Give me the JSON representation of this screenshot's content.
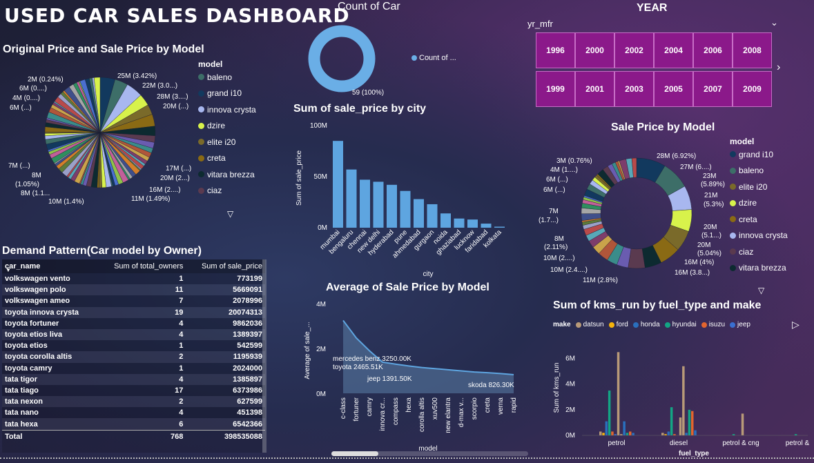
{
  "dashboard": {
    "title": "USED CAR SALES DASHBOARD"
  },
  "donut_count": {
    "title": "Count of Car",
    "legend_label": "Count of ...",
    "data_label": "59 (100%)",
    "color": "#6aaee6",
    "chart_data": {
      "type": "pie",
      "values": [
        59
      ],
      "labels": [
        "Count of ..."
      ]
    }
  },
  "year_slicer": {
    "title": "YEAR",
    "field": "yr_mfr",
    "years_row1": [
      "1996",
      "2000",
      "2002",
      "2004",
      "2006",
      "2008"
    ],
    "years_row2": [
      "1999",
      "2001",
      "2003",
      "2005",
      "2007",
      "2009"
    ],
    "button_color": "#8b198a"
  },
  "pie_orig": {
    "title": "Original Price and Sale Price by Model",
    "legend_title": "model",
    "legend": [
      {
        "name": "baleno",
        "color": "#3d6e68"
      },
      {
        "name": "grand i10",
        "color": "#12395e"
      },
      {
        "name": "innova crysta",
        "color": "#a8b7ef"
      },
      {
        "name": "dzire",
        "color": "#d8f24b"
      },
      {
        "name": "elite i20",
        "color": "#7a6a2a"
      },
      {
        "name": "creta",
        "color": "#8a6a14"
      },
      {
        "name": "vitara brezza",
        "color": "#0d2a30"
      },
      {
        "name": "ciaz",
        "color": "#5a3a4f"
      }
    ],
    "labels_left": [
      "2M (0.24%)",
      "6M (0....)",
      "4M (0....)",
      "6M (...)",
      "7M (...)",
      "8M",
      "(1.05%)",
      "8M (1.1...",
      "10M (1.4%)"
    ],
    "labels_right": [
      "25M (3.42%)",
      "22M (3.0...)",
      "28M (3....)",
      "20M (...)",
      "17M (...)",
      "20M (2...)",
      "16M (2....)",
      "11M (1.49%)"
    ],
    "chart_data": {
      "type": "pie",
      "values_m": [
        25,
        22,
        28,
        20,
        17,
        20,
        16,
        11,
        10,
        8,
        8,
        7,
        6,
        4,
        6,
        2
      ],
      "labels": [
        "25M (3.42%)",
        "22M (3.0...)",
        "28M (3....)",
        "20M (...)",
        "17M (...)",
        "20M (2...)",
        "16M (2....)",
        "11M (1.49%)",
        "10M (1.4%)",
        "8M (1.1...",
        "8M (1.05%)",
        "7M (...)",
        "6M (...)",
        "4M (0....)",
        "6M (0....)",
        "2M (0.24%)"
      ]
    }
  },
  "bar_city": {
    "title": "Sum of sale_price by city",
    "xlabel": "city",
    "ylabel": "Sum of sale_price",
    "yticks": [
      "100M",
      "50M",
      "0M"
    ],
    "color": "#5ea5e0",
    "chart_data": {
      "type": "bar",
      "categories": [
        "mumbai",
        "bengaluru",
        "chennai",
        "new delhi",
        "hyderabad",
        "pune",
        "ahmedabad",
        "gurgaon",
        "noida",
        "ghaziabad",
        "lucknow",
        "faridabad",
        "kolkata"
      ],
      "values": [
        85,
        57,
        47,
        45,
        42,
        36,
        28,
        23,
        14,
        9,
        8,
        4,
        1
      ],
      "ylim": [
        0,
        100
      ]
    }
  },
  "area_avg": {
    "title": "Average of Sale Price by Model",
    "xlabel": "model",
    "ylabel": "Average of sale_...",
    "yticks": [
      "4M",
      "2M",
      "0M"
    ],
    "annotations": [
      "mercedes benz 3250.00K",
      "toyota 2465.51K",
      "jeep 1391.50K",
      "skoda 826.30K"
    ],
    "chart_data": {
      "type": "area",
      "categories": [
        "c-class",
        "fortuner",
        "camry",
        "innova cr...",
        "compass",
        "hexa",
        "corolla altis",
        "xuv500",
        "new elantra",
        "d-max v...",
        "scorpio",
        "creta",
        "verna",
        "rapid"
      ],
      "values": [
        3.25,
        2.47,
        1.9,
        1.39,
        1.3,
        1.22,
        1.15,
        1.1,
        1.05,
        1.0,
        0.95,
        0.92,
        0.88,
        0.83
      ],
      "ylim": [
        0,
        4
      ]
    }
  },
  "pie_sale": {
    "title": "Sale Price by Model",
    "legend_title": "model",
    "legend": [
      {
        "name": "grand i10",
        "color": "#12395e"
      },
      {
        "name": "baleno",
        "color": "#3d6e68"
      },
      {
        "name": "elite i20",
        "color": "#7a6a2a"
      },
      {
        "name": "dzire",
        "color": "#d8f24b"
      },
      {
        "name": "creta",
        "color": "#8a6a14"
      },
      {
        "name": "innova crysta",
        "color": "#a8b7ef"
      },
      {
        "name": "ciaz",
        "color": "#5a3a4f"
      },
      {
        "name": "vitara brezza",
        "color": "#0d2a30"
      }
    ],
    "labels_left": [
      "3M (0.76%)",
      "4M (1....)",
      "6M (...)",
      "6M (...)",
      "7M",
      "(1.7...)",
      "8M",
      "(2.11%)",
      "10M (2....)",
      "10M (2.4....)",
      "11M (2.8%)"
    ],
    "labels_right": [
      "28M (6.92%)",
      "27M (6....)",
      "23M",
      "(5.89%)",
      "21M",
      "(5.3%)",
      "20M",
      "(5.1...)",
      "20M",
      "(5.04%)",
      "16M (4%)",
      "16M (3.8...)"
    ],
    "chart_data": {
      "type": "pie",
      "values_m": [
        28,
        27,
        23,
        21,
        20,
        20,
        16,
        16,
        11,
        10,
        10,
        8,
        7,
        6,
        6,
        4,
        3
      ]
    }
  },
  "bar_kms": {
    "title": "Sum of kms_run by fuel_type and make",
    "legend_title": "make",
    "legend": [
      {
        "name": "datsun",
        "color": "#b89a78"
      },
      {
        "name": "ford",
        "color": "#f6b40c"
      },
      {
        "name": "honda",
        "color": "#2a6fbd"
      },
      {
        "name": "hyundai",
        "color": "#13a584"
      },
      {
        "name": "isuzu",
        "color": "#e2652e"
      },
      {
        "name": "jeep",
        "color": "#3a6fd0"
      }
    ],
    "xlabel": "fuel_type",
    "ylabel": "Sum of kms_run",
    "yticks": [
      "6M",
      "4M",
      "2M",
      "0M"
    ],
    "chart_data": {
      "type": "bar",
      "categories": [
        "petrol",
        "diesel",
        "petrol & cng",
        "petrol & lpg"
      ],
      "series_values_m": [
        [
          0.3,
          0.2,
          1.1,
          3.5,
          0.3,
          0.1,
          6.5,
          0.1,
          1.1,
          0.2,
          0.3,
          0.2
        ],
        [
          0.2,
          0.1,
          0.3,
          2.2,
          0.1,
          0.0,
          1.4,
          5.4,
          0.2,
          2.0,
          1.9,
          0.4
        ],
        [
          0.0,
          0.0,
          0.0,
          0.1,
          0.0,
          0.0,
          1.7,
          0.0,
          0.0,
          0.0,
          0.0,
          0.0
        ],
        [
          0.0,
          0.0,
          0.0,
          0.1,
          0.0,
          0.0,
          0.0,
          0.0,
          0.0,
          0.0,
          0.0,
          0.0
        ]
      ],
      "bar_colors": [
        "#b89a78",
        "#f6b40c",
        "#2a6fbd",
        "#13a584",
        "#e2652e",
        "#3a6fd0",
        "#b89a78",
        "#b89a78",
        "#2a6fbd",
        "#13a584",
        "#e2652e",
        "#2a6fbd"
      ],
      "ylim": [
        0,
        7
      ]
    }
  },
  "table": {
    "title": "Demand Pattern(Car model by Owner)",
    "headers": [
      "car_name",
      "Sum of total_owners",
      "Sum of sale_price"
    ],
    "rows": [
      [
        "volkswagen vento",
        "1",
        "773199"
      ],
      [
        "volkswagen polo",
        "11",
        "5669091"
      ],
      [
        "volkswagen ameo",
        "7",
        "2078996"
      ],
      [
        "toyota innova crysta",
        "19",
        "20074313"
      ],
      [
        "toyota fortuner",
        "4",
        "9862036"
      ],
      [
        "toyota etios liva",
        "4",
        "1389397"
      ],
      [
        "toyota etios",
        "1",
        "542599"
      ],
      [
        "toyota corolla altis",
        "2",
        "1195939"
      ],
      [
        "toyota camry",
        "1",
        "2024000"
      ],
      [
        "tata tigor",
        "4",
        "1385897"
      ],
      [
        "tata tiago",
        "17",
        "6373986"
      ],
      [
        "tata nexon",
        "2",
        "627599"
      ],
      [
        "tata nano",
        "4",
        "451398"
      ],
      [
        "tata hexa",
        "6",
        "6542366"
      ]
    ],
    "total": [
      "Total",
      "768",
      "398535088"
    ]
  }
}
